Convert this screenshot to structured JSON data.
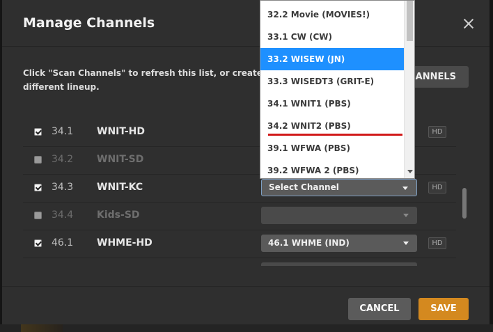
{
  "modal": {
    "title": "Manage Channels",
    "description": "Click \"Scan Channels\" to refresh this list, or create a new DV",
    "description_line2": "different lineup.",
    "scan_button_label": "CHANNELS",
    "cancel_label": "CANCEL",
    "save_label": "SAVE"
  },
  "channels": [
    {
      "checked": true,
      "number": "34.1",
      "name": "WNIT-HD",
      "selection": "",
      "hd": "HD"
    },
    {
      "checked": false,
      "number": "34.2",
      "name": "WNIT-SD",
      "selection": "",
      "hd": ""
    },
    {
      "checked": true,
      "number": "34.3",
      "name": "WNIT-KC",
      "selection": "Select Channel",
      "hd": "HD"
    },
    {
      "checked": false,
      "number": "34.4",
      "name": "Kids-SD",
      "selection": "",
      "hd": ""
    },
    {
      "checked": true,
      "number": "46.1",
      "name": "WHME-HD",
      "selection": "46.1 WHME (IND)",
      "hd": "HD"
    }
  ],
  "dropdown": {
    "options": [
      "32.2 Movie (MOVIES!)",
      "33.1 CW (CW)",
      "33.2 WISEW (JN)",
      "33.3 WISEDT3 (GRIT-E)",
      "34.1 WNIT1 (PBS)",
      "34.2 WNIT2 (PBS)",
      "39.1 WFWA (PBS)",
      "39.2 WFWA 2 (PBS)"
    ],
    "highlighted": "33.2 WISEW (JN)"
  },
  "colors": {
    "accent_save": "#d4891f",
    "selection_highlight": "#1e90ff",
    "annotation_red": "#d11a1a"
  }
}
